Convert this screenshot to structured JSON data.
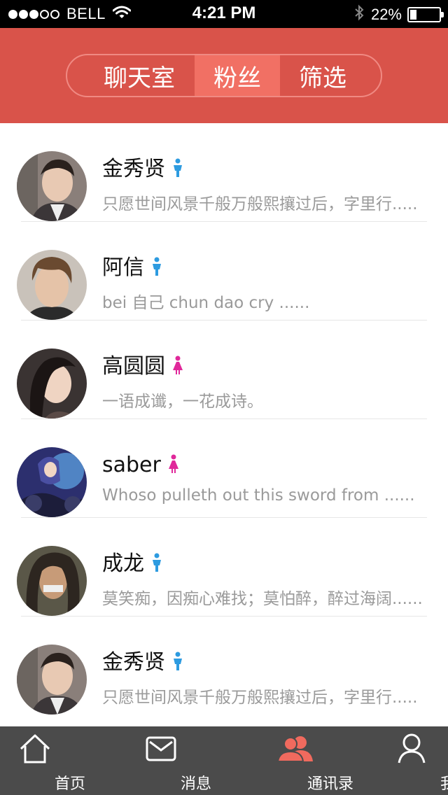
{
  "status_bar": {
    "carrier": "BELL",
    "time": "4:21 PM",
    "battery": "22%",
    "battery_level": 0.22
  },
  "header": {
    "segments": [
      {
        "label": "聊天室",
        "selected": false
      },
      {
        "label": "粉丝",
        "selected": true
      },
      {
        "label": "筛选",
        "selected": false
      }
    ]
  },
  "contacts": [
    {
      "name": "金秀贤",
      "gender": "male",
      "message": "只愿世间风景千般万般熙攘过后，字里行....."
    },
    {
      "name": "阿信",
      "gender": "male",
      "message": "bei 自己 chun dao  cry ......"
    },
    {
      "name": "高圆圆",
      "gender": "female",
      "message": "一语成谶，一花成诗。"
    },
    {
      "name": "saber",
      "gender": "female",
      "message": "Whoso pulleth out this sword from ......"
    },
    {
      "name": "成龙",
      "gender": "male",
      "message": "莫笑痴，因痴心难找；莫怕醉，醉过海阔......"
    },
    {
      "name": "金秀贤",
      "gender": "male",
      "message": "只愿世间风景千般万般熙攘过后，字里行....."
    }
  ],
  "tabbar": {
    "tabs": [
      {
        "label": "首页",
        "icon": "home-icon",
        "active": false
      },
      {
        "label": "消息",
        "icon": "mail-icon",
        "active": false
      },
      {
        "label": "通讯录",
        "icon": "contacts-icon",
        "active": true
      },
      {
        "label": "我",
        "icon": "user-icon",
        "active": false
      }
    ]
  },
  "colors": {
    "accent": "#d9534a",
    "segment_selected": "#f17064",
    "male": "#2d9be0",
    "female": "#e0289a",
    "tab_active_icon": "#f06a5e",
    "tabbar_bg": "#4b4b4b"
  }
}
